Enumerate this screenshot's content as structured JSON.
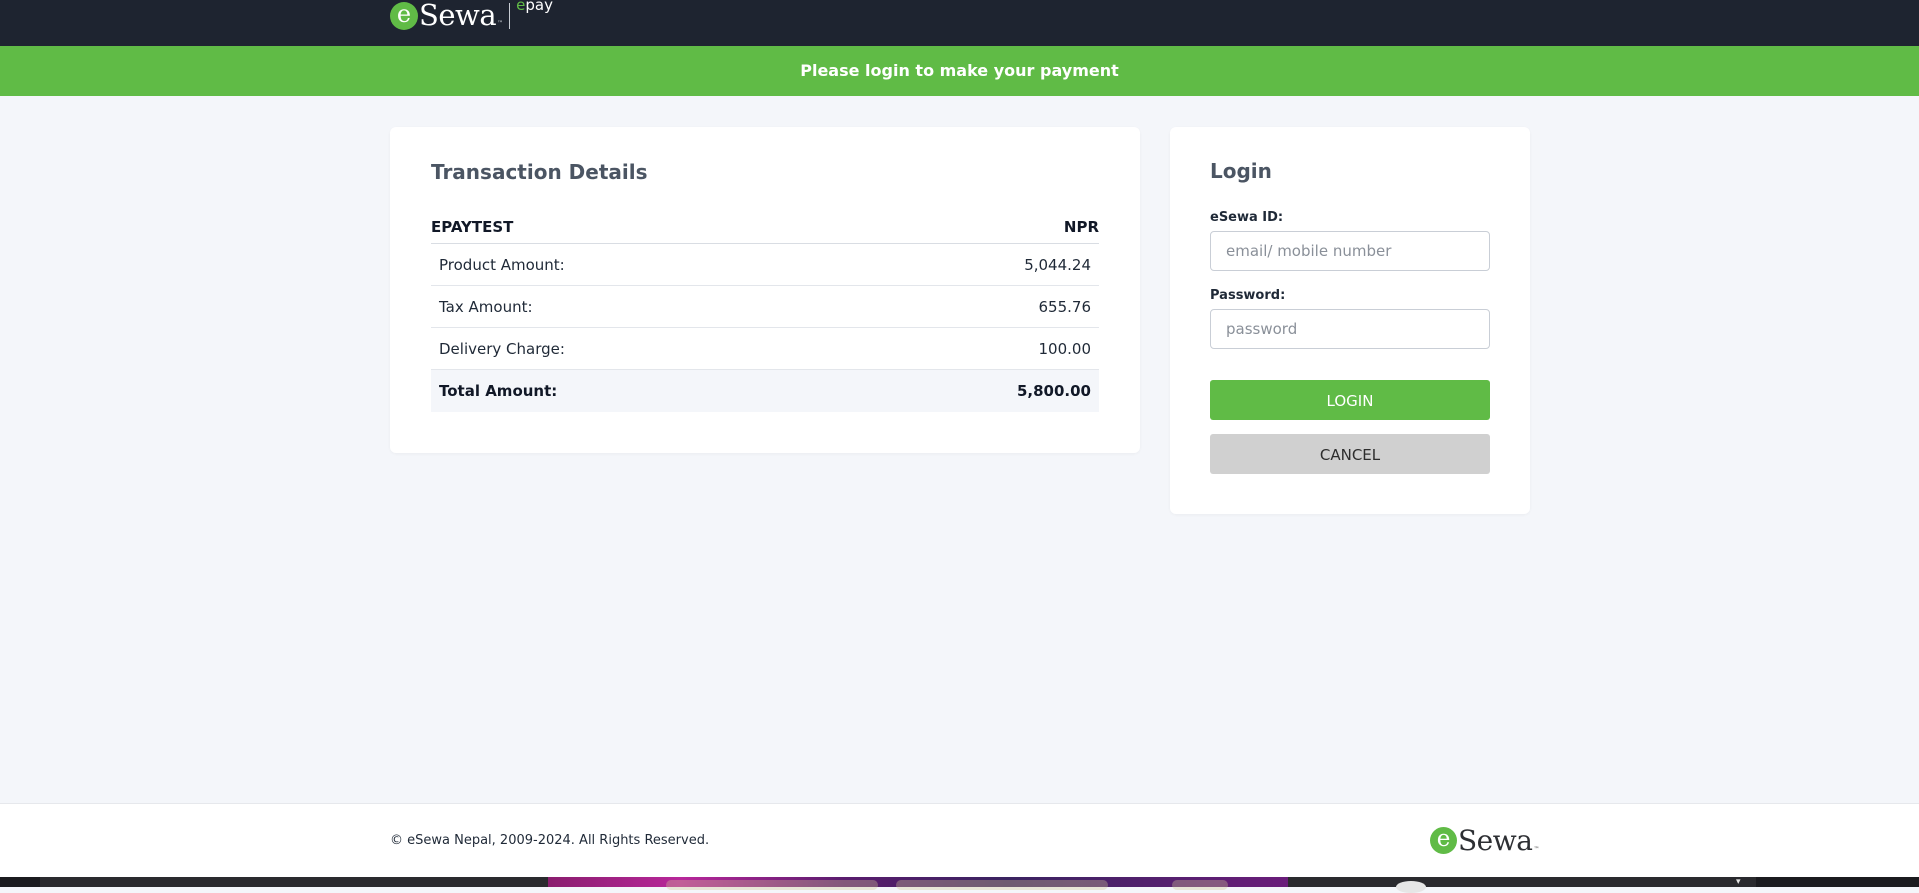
{
  "brand": {
    "logo_e": "e",
    "logo_name": "Sewa",
    "logo_tm": "™",
    "product_e": "e",
    "product_name": "pay"
  },
  "banner": {
    "message": "Please login to make your payment"
  },
  "transaction": {
    "title": "Transaction Details",
    "merchant": "EPAYTEST",
    "currency": "NPR",
    "rows": [
      {
        "label": "Product Amount:",
        "value": "5,044.24"
      },
      {
        "label": "Tax Amount:",
        "value": "655.76"
      },
      {
        "label": "Delivery Charge:",
        "value": "100.00"
      }
    ],
    "total": {
      "label": "Total Amount:",
      "value": "5,800.00"
    }
  },
  "login": {
    "title": "Login",
    "id_label": "eSewa ID:",
    "id_placeholder": "email/ mobile number",
    "id_value": "",
    "password_label": "Password:",
    "password_placeholder": "password",
    "password_value": "",
    "login_button": "LOGIN",
    "cancel_button": "CANCEL"
  },
  "footer": {
    "copyright": "© eSewa Nepal, 2009-2024. All Rights Reserved."
  },
  "colors": {
    "brand_green": "#60bb46",
    "topbar_dark": "#1e2430",
    "page_background": "#f4f6fa",
    "cancel_gray": "#d0d0d0"
  },
  "icons": {
    "brand_logo": "esewa-logo-icon",
    "footer_logo": "esewa-logo-icon"
  }
}
